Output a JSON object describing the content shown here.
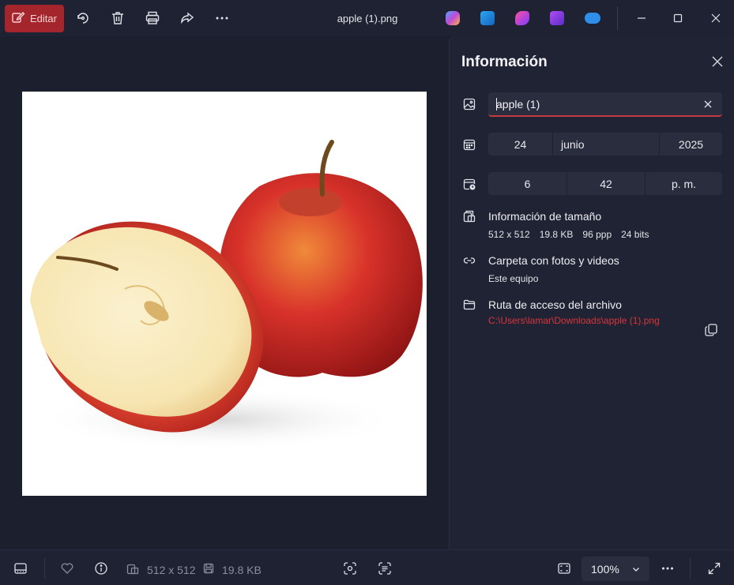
{
  "toolbar": {
    "edit_label": "Editar",
    "file_title": "apple (1).png",
    "icons": [
      "edit-icon",
      "rotate-icon",
      "delete-icon",
      "print-icon",
      "share-icon",
      "more-icon"
    ],
    "apps": [
      "copilot-icon",
      "paint-icon",
      "designer-icon",
      "clipchamp-icon",
      "onedrive-icon"
    ],
    "window_controls": [
      "minimize-icon",
      "maximize-icon",
      "close-icon"
    ]
  },
  "viewer": {
    "image_alt": "apple (1).png"
  },
  "info_panel": {
    "title": "Información",
    "name_value": "apple (1)",
    "date": {
      "day": "24",
      "month": "junio",
      "year": "2025"
    },
    "time": {
      "hour": "6",
      "minute": "42",
      "period": "p. m."
    },
    "size_section": {
      "title": "Información de tamaño",
      "dimensions": "512 x 512",
      "file_size": "19.8 KB",
      "dpi": "96 ppp",
      "bit_depth": "24 bits"
    },
    "folder_section": {
      "title": "Carpeta con fotos y videos",
      "value": "Este equipo"
    },
    "path_section": {
      "title": "Ruta de acceso del archivo",
      "value": "C:\\Users\\lamar\\Downloads\\apple (1).png"
    }
  },
  "bottombar": {
    "dimensions": "512 x 512",
    "file_size": "19.8 KB",
    "zoom": "100%"
  },
  "colors": {
    "accent": "#a4262c",
    "link": "#d8353c",
    "background": "#1c1f2e",
    "panel": "#202333"
  }
}
